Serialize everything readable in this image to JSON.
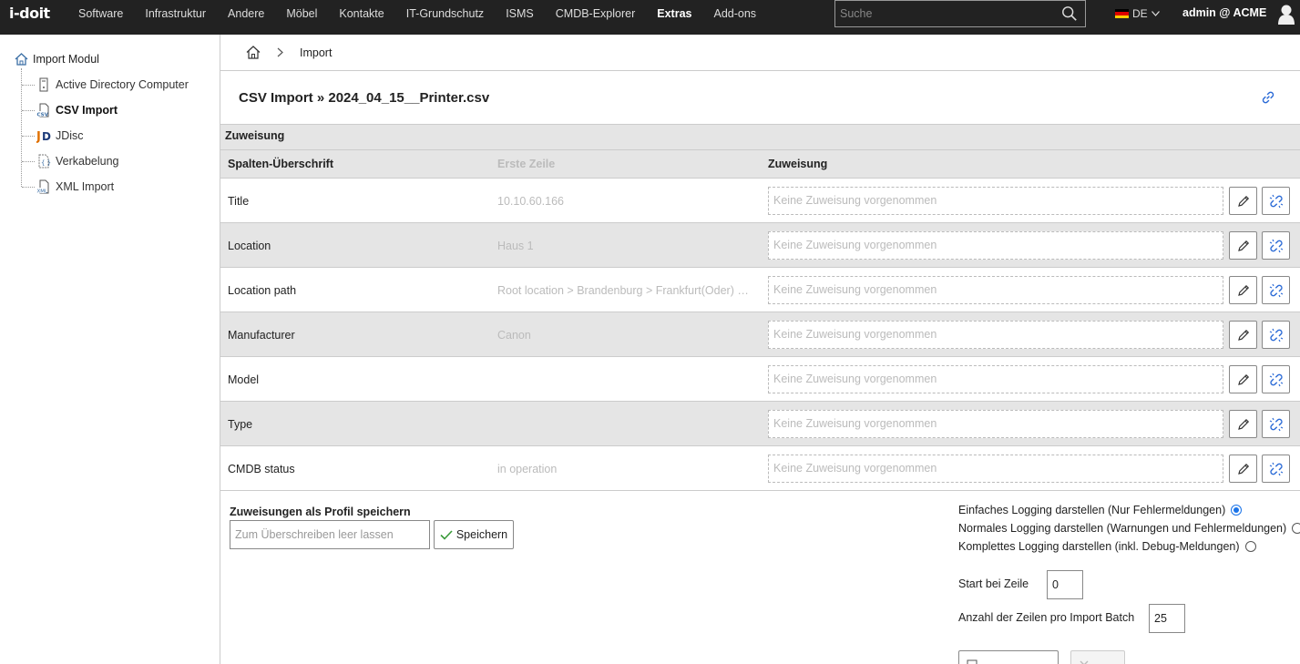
{
  "topbar": {
    "logo": "i-doit",
    "nav": [
      {
        "label": "Software",
        "active": false
      },
      {
        "label": "Infrastruktur",
        "active": false
      },
      {
        "label": "Andere",
        "active": false
      },
      {
        "label": "Möbel",
        "active": false
      },
      {
        "label": "Kontakte",
        "active": false
      },
      {
        "label": "IT-Grundschutz",
        "active": false
      },
      {
        "label": "ISMS",
        "active": false
      },
      {
        "label": "CMDB-Explorer",
        "active": false
      },
      {
        "label": "Extras",
        "active": true
      },
      {
        "label": "Add-ons",
        "active": false
      }
    ],
    "search_placeholder": "Suche",
    "language": "DE",
    "user": "admin @ ACME"
  },
  "sidebar": {
    "root_label": "Import Modul",
    "items": [
      {
        "label": "Active Directory Computer",
        "icon": "server-icon",
        "active": false
      },
      {
        "label": "CSV Import",
        "icon": "csv-file-icon",
        "active": true
      },
      {
        "label": "JDisc",
        "icon": "jdisc-icon",
        "active": false
      },
      {
        "label": "Verkabelung",
        "icon": "cabling-file-icon",
        "active": false
      },
      {
        "label": "XML Import",
        "icon": "xml-file-icon",
        "active": false
      }
    ]
  },
  "breadcrumb": {
    "home_icon": "home-icon",
    "current": "Import"
  },
  "page_title": "CSV Import » 2024_04_15__Printer.csv",
  "section_title": "Zuweisung",
  "columns": {
    "header": "Spalten-Überschrift",
    "first_row": "Erste Zeile",
    "assignment": "Zuweisung"
  },
  "rows": [
    {
      "header": "Title",
      "first_row": "10.10.60.166",
      "assignment": "Keine Zuweisung vorgenommen"
    },
    {
      "header": "Location",
      "first_row": "Haus 1",
      "assignment": "Keine Zuweisung vorgenommen"
    },
    {
      "header": "Location path",
      "first_row": "Root location > Brandenburg > Frankfurt(Oder) > ...",
      "assignment": "Keine Zuweisung vorgenommen"
    },
    {
      "header": "Manufacturer",
      "first_row": "Canon",
      "assignment": "Keine Zuweisung vorgenommen"
    },
    {
      "header": "Model",
      "first_row": "",
      "assignment": "Keine Zuweisung vorgenommen"
    },
    {
      "header": "Type",
      "first_row": "",
      "assignment": "Keine Zuweisung vorgenommen"
    },
    {
      "header": "CMDB status",
      "first_row": "in operation",
      "assignment": "Keine Zuweisung vorgenommen"
    }
  ],
  "profile": {
    "title": "Zuweisungen als Profil speichern",
    "input_placeholder": "Zum Überschreiben leer lassen",
    "save_label": "Speichern"
  },
  "logging": [
    {
      "label": "Einfaches Logging darstellen (Nur Fehlermeldungen)",
      "checked": true
    },
    {
      "label": "Normales Logging darstellen (Warnungen und Fehlermeldungen)",
      "checked": false
    },
    {
      "label": "Komplettes Logging darstellen (inkl. Debug-Meldungen)",
      "checked": false
    }
  ],
  "start_row": {
    "label": "Start bei Zeile",
    "value": "0"
  },
  "batch_size": {
    "label": "Anzahl der Zeilen pro Import Batch",
    "value": "25"
  },
  "colors": {
    "topbar_bg": "#222222",
    "row_alt_bg": "#e5e5e5",
    "accent": "#1a73e8"
  }
}
